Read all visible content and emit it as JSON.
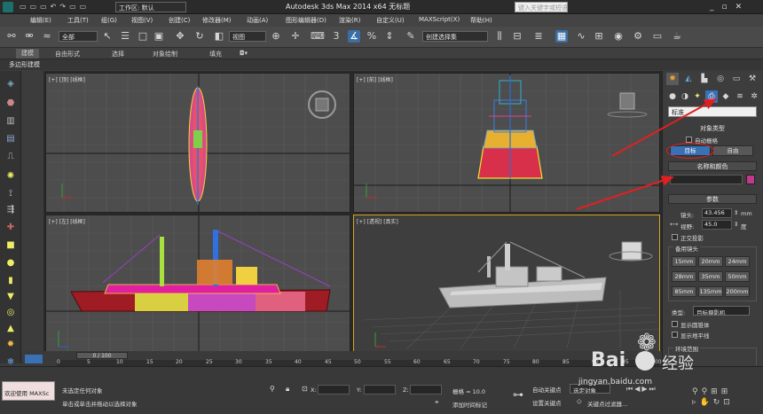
{
  "title_bar": {
    "workspace": "工作区: 默认",
    "app_title": "Autodesk 3ds Max  2014 x64    无标题",
    "search_placeholder": "键入关键字或短语"
  },
  "menus": [
    "编辑(E)",
    "工具(T)",
    "组(G)",
    "视图(V)",
    "创建(C)",
    "修改器(M)",
    "动画(A)",
    "图形编辑器(D)",
    "渲染(R)",
    "自定义(U)",
    "MAXScript(X)",
    "帮助(H)"
  ],
  "toolbar": {
    "selection_filter": "全部",
    "reference_coord": "视图",
    "named_selection": "创建选择集"
  },
  "ribbon": {
    "tabs": [
      "建模",
      "自由形式",
      "选择",
      "对象绘制",
      "填充"
    ],
    "active_tab": "建模",
    "sub_label": "多边形建模"
  },
  "viewports": {
    "top": "[+] [顶] [线框]",
    "front": "[+] [前] [线框]",
    "left": "[+] [左] [线框]",
    "perspective": "[+] [透视] [真实]"
  },
  "command_panel": {
    "category_dropdown": "标准",
    "object_type_header": "对象类型",
    "autogrid_label": "自动栅格",
    "btn_target": "目标",
    "btn_free": "自由",
    "name_color_header": "名称和颜色",
    "params_header": "参数",
    "lens_label": "镜头:",
    "lens_value": "43.456",
    "lens_unit": "mm",
    "fov_label": "视野:",
    "fov_value": "45.0",
    "fov_unit": "度",
    "ortho_label": "正交投影",
    "stock_lenses_label": "备用镜头",
    "lenses": [
      "15mm",
      "20mm",
      "24mm",
      "28mm",
      "35mm",
      "50mm",
      "85mm",
      "135mm",
      "200mm"
    ],
    "type_label": "类型:",
    "type_value": "目标摄影机",
    "show_cone_label": "显示圆锥体",
    "show_horizon_label": "显示地平线",
    "env_range_label": "环境范围"
  },
  "timeline": {
    "frame_display": "0 / 100",
    "ticks": [
      "0",
      "5",
      "10",
      "15",
      "20",
      "25",
      "30",
      "35",
      "40",
      "45",
      "50",
      "55",
      "60",
      "65",
      "70",
      "75",
      "80",
      "85",
      "90",
      "95",
      "100"
    ]
  },
  "status": {
    "welcome": "欢迎使用 MAXSc",
    "no_selection": "未选定任何对象",
    "prompt": "单击或单击并拖动以选择对象",
    "x_label": "X:",
    "y_label": "Y:",
    "z_label": "Z:",
    "grid": "栅格 = 10.0",
    "add_time_tag": "添加时间标记",
    "auto_key": "自动关键点",
    "set_key": "设置关键点",
    "selected": "选定对象",
    "key_filters": "关键点过滤器..."
  },
  "watermark": {
    "brand": "Bai",
    "brand_suffix": "经验",
    "url": "jingyan.baidu.com"
  },
  "colors": {
    "accent_blue": "#3a70b4",
    "active_viewport": "#d4a520",
    "annotation_red": "#e02020",
    "camera_swatch": "#c0398a"
  }
}
